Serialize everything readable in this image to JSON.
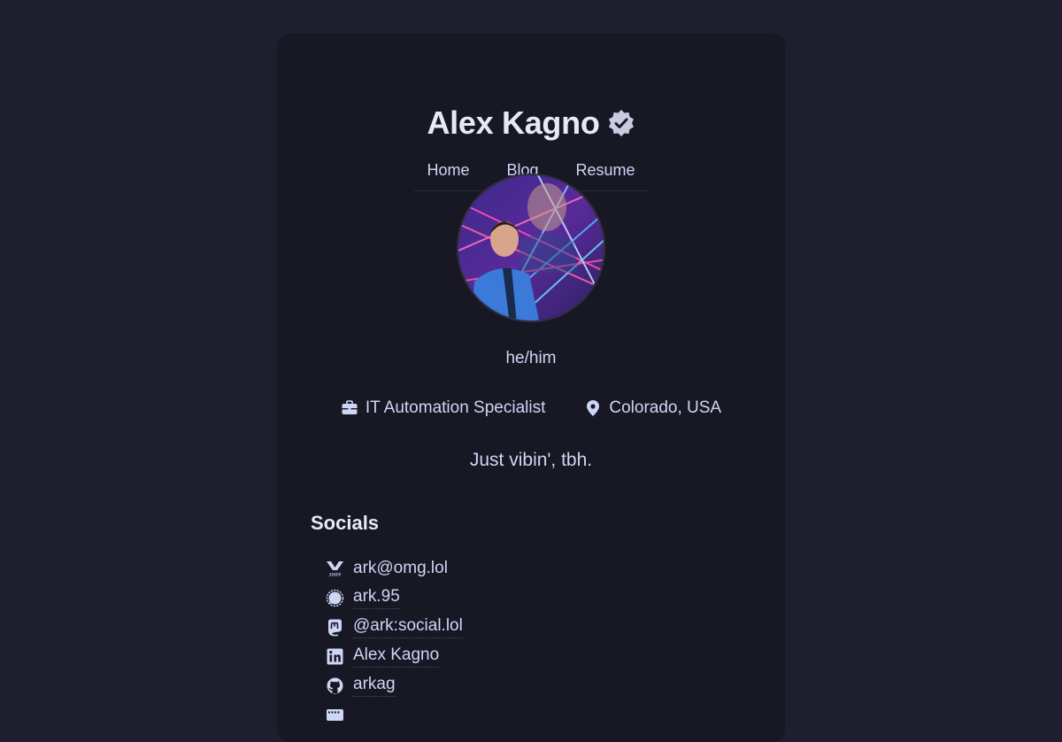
{
  "profile": {
    "name": "Alex Kagno",
    "pronouns": "he/him",
    "occupation": "IT Automation Specialist",
    "location": "Colorado, USA",
    "bio": "Just vibin', tbh."
  },
  "nav": {
    "home": "Home",
    "blog": "Blog",
    "resume": "Resume"
  },
  "socials": {
    "title": "Socials",
    "items": [
      {
        "icon": "xmpp-icon",
        "label": "ark@omg.lol"
      },
      {
        "icon": "signal-icon",
        "label": "ark.95"
      },
      {
        "icon": "mastodon-icon",
        "label": "@ark:social.lol"
      },
      {
        "icon": "linkedin-icon",
        "label": "Alex Kagno"
      },
      {
        "icon": "github-icon",
        "label": "arkag"
      }
    ]
  },
  "colors": {
    "page_bg": "#1e1e2e",
    "card_bg": "#181825",
    "text": "#cdd6f4"
  }
}
